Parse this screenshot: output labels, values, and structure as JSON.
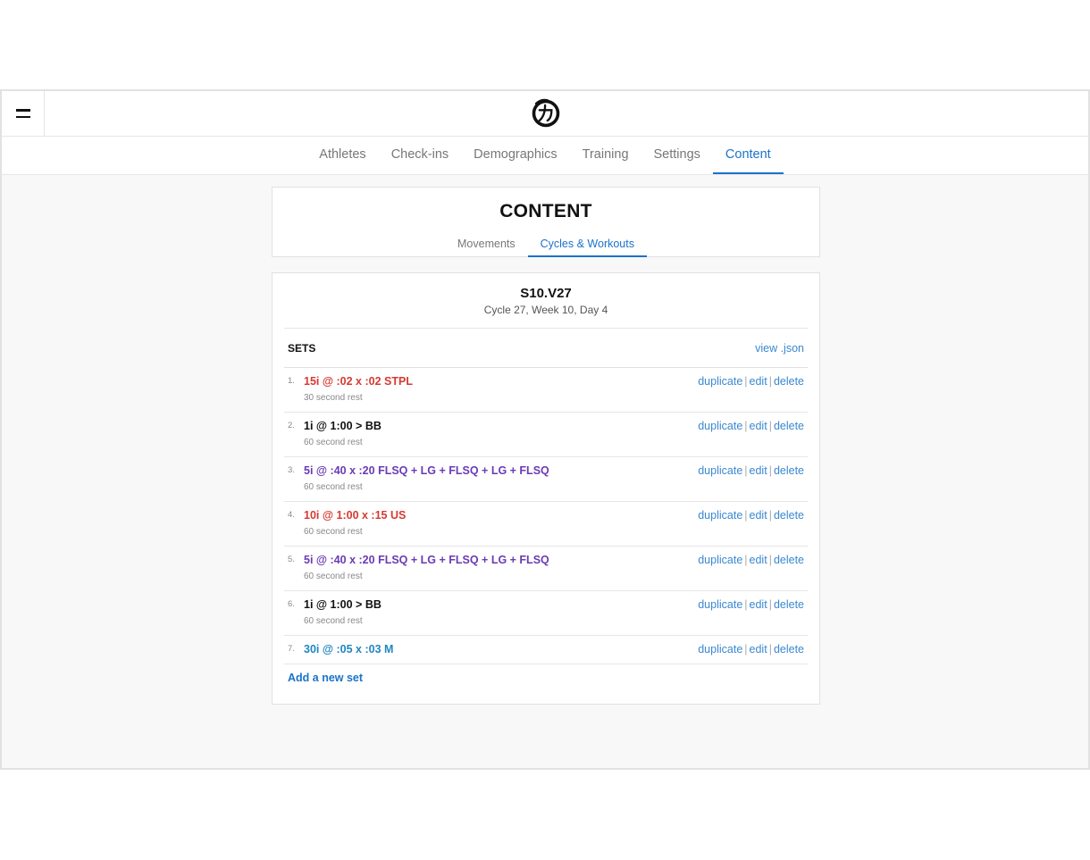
{
  "nav": {
    "tabs": [
      {
        "label": "Athletes"
      },
      {
        "label": "Check-ins"
      },
      {
        "label": "Demographics"
      },
      {
        "label": "Training"
      },
      {
        "label": "Settings"
      },
      {
        "label": "Content"
      }
    ],
    "active": "Content"
  },
  "content": {
    "title": "CONTENT",
    "subtabs": [
      {
        "label": "Movements"
      },
      {
        "label": "Cycles & Workouts"
      }
    ],
    "active_subtab": "Cycles & Workouts"
  },
  "workout": {
    "title": "S10.V27",
    "subtitle": "Cycle 27, Week 10, Day 4"
  },
  "sets": {
    "label": "SETS",
    "view_json": "view .json",
    "add_label": "Add a new set",
    "action_labels": {
      "duplicate": "duplicate",
      "edit": "edit",
      "delete": "delete",
      "separator": "|"
    },
    "items": [
      {
        "num": "1.",
        "name": "15i @ :02 x :02 STPL",
        "rest": "30 second rest",
        "color": "#d63a32"
      },
      {
        "num": "2.",
        "name": "1i @ 1:00 > BB",
        "rest": "60 second rest",
        "color": "#111111"
      },
      {
        "num": "3.",
        "name": "5i @ :40 x :20 FLSQ + LG + FLSQ + LG + FLSQ",
        "rest": "60 second rest",
        "color": "#6a3bb5"
      },
      {
        "num": "4.",
        "name": "10i @ 1:00 x :15 US",
        "rest": "60 second rest",
        "color": "#d63a32"
      },
      {
        "num": "5.",
        "name": "5i @ :40 x :20 FLSQ + LG + FLSQ + LG + FLSQ",
        "rest": "60 second rest",
        "color": "#6a3bb5"
      },
      {
        "num": "6.",
        "name": "1i @ 1:00 > BB",
        "rest": "60 second rest",
        "color": "#111111"
      },
      {
        "num": "7.",
        "name": "30i @ :05 x :03 M",
        "rest": "",
        "color": "#1f86c2"
      }
    ]
  },
  "colors": {
    "accent": "#1a73c8",
    "link": "#3a88d0"
  }
}
